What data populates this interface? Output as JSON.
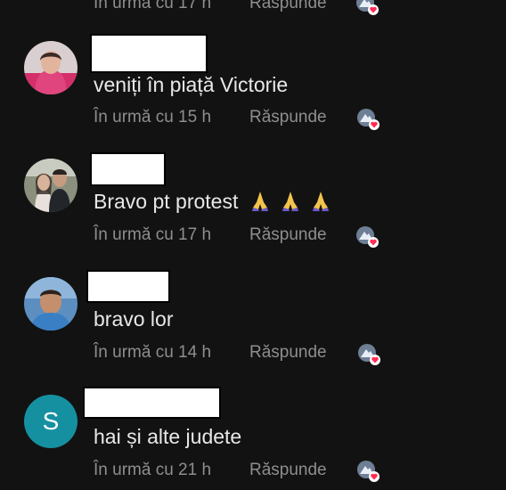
{
  "comments": [
    {
      "id": "c0",
      "text": "",
      "time": "În urmă cu 17 h",
      "reply": "Răspunde"
    },
    {
      "id": "c1",
      "text": "veniți în piață Victorie",
      "time": "În urmă cu 15 h",
      "reply": "Răspunde"
    },
    {
      "id": "c2",
      "text": "Bravo pt protest",
      "emoji": "🙏🙏🙏",
      "time": "În urmă cu 17 h",
      "reply": "Răspunde"
    },
    {
      "id": "c3",
      "text": "bravo lor",
      "time": "În urmă cu 14 h",
      "reply": "Răspunde"
    },
    {
      "id": "c4",
      "avatar_letter": "S",
      "text": "hai și alte judete",
      "time": "În urmă cu 21 h",
      "reply": "Răspunde"
    }
  ],
  "colors": {
    "background": "#121212",
    "text": "#e8e8e8",
    "meta": "#8e8e8e",
    "avatar_letter_bg": "#1590a0",
    "heart": "#ff2d55"
  },
  "icons": {
    "reaction": "heart-reaction-icon",
    "emoji": "folded-hands-emoji"
  }
}
